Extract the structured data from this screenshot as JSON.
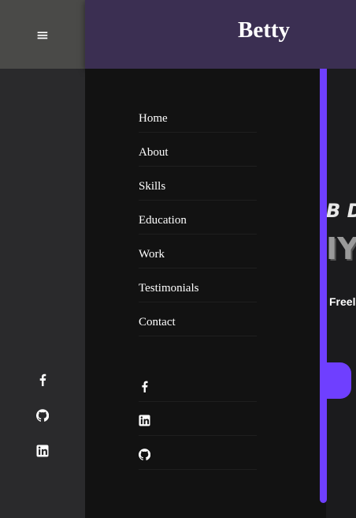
{
  "header": {
    "brand": "Betty"
  },
  "rail": {
    "menu_glyph": "≡",
    "social_icons": [
      "facebook-icon",
      "github-icon",
      "linkedin-icon"
    ]
  },
  "nav": {
    "items": [
      "Home",
      "About",
      "Skills",
      "Education",
      "Work",
      "Testimonials",
      "Contact"
    ],
    "social_icons": [
      "facebook-icon",
      "linkedin-icon",
      "github-icon"
    ]
  },
  "hero": {
    "line1": "B DI",
    "line2": "IY",
    "line3": "Freela"
  },
  "colors": {
    "accent": "#6f3fff",
    "header_bg": "#3b2f52",
    "rail_bg": "#2a2a2c",
    "panel_bg": "#121212"
  }
}
